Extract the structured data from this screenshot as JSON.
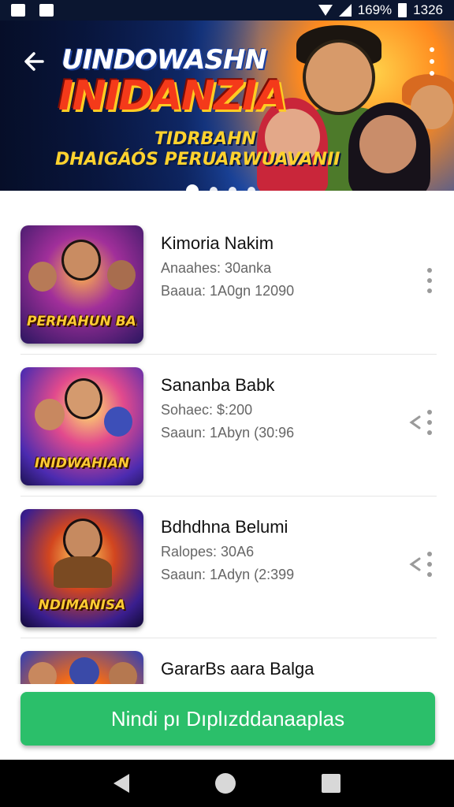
{
  "status_bar": {
    "battery": "169%",
    "time": "1326"
  },
  "hero": {
    "title_line1": "UINDOWASHN",
    "title_line2": "INIDANZIA",
    "subtitle_line1": "TIDRBAHN",
    "subtitle_line2": "DHAIGÁÓS PERUARWUAVANII",
    "slides": 4,
    "active_slide": 1
  },
  "games": [
    {
      "title": "Kimoria Nakim",
      "line1": "Anaahes: 30anka",
      "line2": "Baaua: 1A0gn  12090",
      "thumb_label": "PERHAHUN BAN",
      "share": false
    },
    {
      "title": "Sananba Babk",
      "line1": "Sohaec: $:200",
      "line2": "Saaun: 1Abyn (30:96",
      "thumb_label": "INIDWAHIAN",
      "share": true
    },
    {
      "title": "Bdhdhna Belumi",
      "line1": "Ralopes: 30A6",
      "line2": "Saaun: 1Adyn (2:399",
      "thumb_label": "NDIMANISA",
      "share": true
    },
    {
      "title": "GararBs aara Balga",
      "line1": "",
      "line2": "",
      "thumb_label": "",
      "share": false
    }
  ],
  "cta": {
    "label": "Nindi pı Dıplızddanaaplas",
    "color": "#2bbf6a"
  },
  "colors": {
    "status_bar": "#0b1630",
    "hero_title_red": "#f43a1a",
    "hero_gold": "#ffd22e"
  }
}
